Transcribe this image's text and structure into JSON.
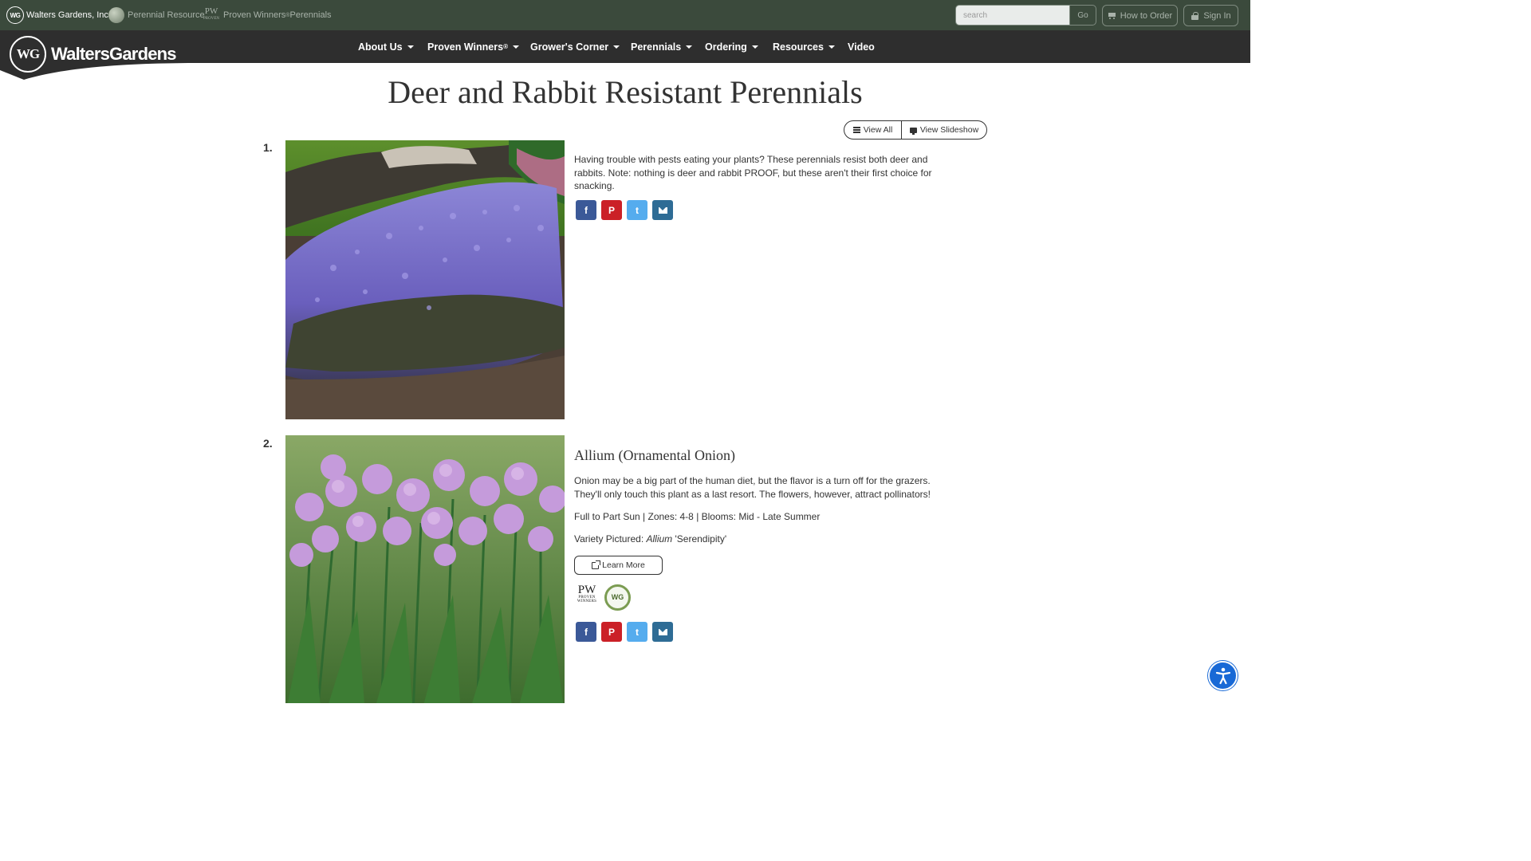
{
  "topbar": {
    "sites": [
      {
        "label": "Walters Gardens, Inc.",
        "icon": "wg-logo-icon"
      },
      {
        "label": "Perennial Resource",
        "icon": "globe-icon"
      },
      {
        "label": "Proven Winners",
        "suffix": " Perennials",
        "icon": "pw-logo-icon"
      }
    ],
    "search_placeholder": "search",
    "search_value": "",
    "go_label": "Go",
    "how_to_order_label": "How to Order",
    "sign_in_label": "Sign In"
  },
  "logo": {
    "mark": "WG",
    "text": "WaltersGardens"
  },
  "nav": {
    "about": "About Us",
    "proven_winners": "Proven Winners",
    "growers_corner": "Grower's Corner",
    "perennials": "Perennials",
    "ordering": "Ordering",
    "resources": "Resources",
    "video": "Video"
  },
  "page": {
    "title": "Deer and Rabbit Resistant Perennials",
    "view_all_label": "View All",
    "view_slideshow_label": "View Slideshow"
  },
  "items": [
    {
      "number": "1.",
      "description": "Having trouble with pests eating your plants? These perennials resist both deer and rabbits. Note: nothing is deer and rabbit PROOF, but these aren't their first choice for snacking.",
      "share": {
        "facebook": "f",
        "pinterest": "P",
        "twitter": "t",
        "email": "email-icon"
      }
    },
    {
      "number": "2.",
      "title": "Allium (Ornamental Onion)",
      "description": "Onion may be a big part of the human diet, but the flavor is a turn off for the grazers. They'll only touch this plant as a last resort. The flowers, however, attract pollinators!",
      "details": "Full to Part Sun | Zones: 4-8 | Blooms: Mid - Late Summer",
      "variety_prefix": "Variety Pictured: ",
      "variety_genus": "Allium",
      "variety_cultivar": " 'Serendipity'",
      "learn_more_label": "Learn More",
      "brand_logos": {
        "pw_mark": "PW",
        "pw_text": "PROVEN WINNERS",
        "wg_mark": "WG"
      },
      "share": {
        "facebook": "f",
        "pinterest": "P",
        "twitter": "t",
        "email": "email-icon"
      }
    }
  ],
  "colors": {
    "topbar": "#3b4a3c",
    "navbar": "#2e2e2e",
    "facebook": "#3b5998",
    "pinterest": "#cb2027",
    "twitter": "#55acee",
    "email": "#2e6c95",
    "accessibility": "#1869d6"
  }
}
